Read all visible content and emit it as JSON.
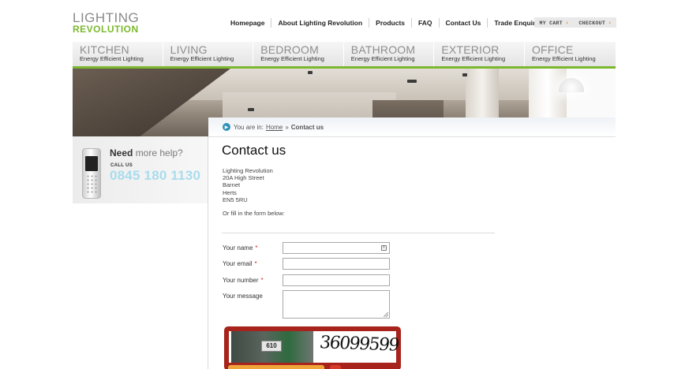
{
  "logo": {
    "line1": "LIGHTING",
    "line2": "REVOLUTION"
  },
  "topnav": [
    {
      "label": "Homepage"
    },
    {
      "label": "About Lighting Revolution"
    },
    {
      "label": "Products"
    },
    {
      "label": "FAQ"
    },
    {
      "label": "Contact Us"
    },
    {
      "label": "Trade Enquiries"
    }
  ],
  "cart": {
    "my_cart": "MY CART",
    "checkout": "CHECKOUT",
    "arrow": "›"
  },
  "categories": [
    {
      "name": "KITCHEN",
      "sub": "Energy Efficient Lighting"
    },
    {
      "name": "LIVING",
      "sub": "Energy Efficient Lighting"
    },
    {
      "name": "BEDROOM",
      "sub": "Energy Efficient Lighting"
    },
    {
      "name": "BATHROOM",
      "sub": "Energy Efficient Lighting"
    },
    {
      "name": "EXTERIOR",
      "sub": "Energy Efficient Lighting"
    },
    {
      "name": "OFFICE",
      "sub": "Energy Efficient Lighting"
    }
  ],
  "breadcrumb": {
    "prefix": "You are in:",
    "home": "Home",
    "sep": "»",
    "current": "Contact us"
  },
  "help": {
    "need": "Need",
    "more": "more help?",
    "call_us": "CALL US",
    "phone": "0845 180 1130"
  },
  "main": {
    "title": "Contact us",
    "address": [
      "Lighting Revolution",
      "20A High Street",
      "Barnet",
      "Herts",
      "EN5 5RU"
    ],
    "or_fill": "Or fill in the form below:"
  },
  "form": {
    "name_label": "Your name",
    "email_label": "Your email",
    "number_label": "Your number",
    "message_label": "Your message",
    "required_mark": "*",
    "name_value": "",
    "email_value": "",
    "number_value": ""
  },
  "captcha": {
    "plate": "610",
    "word": "36099599"
  },
  "colors": {
    "brand_green": "#7cb82f",
    "accent_blue": "#a9dced",
    "captcha_red": "#a7231c",
    "required_red": "#d02b2b"
  }
}
